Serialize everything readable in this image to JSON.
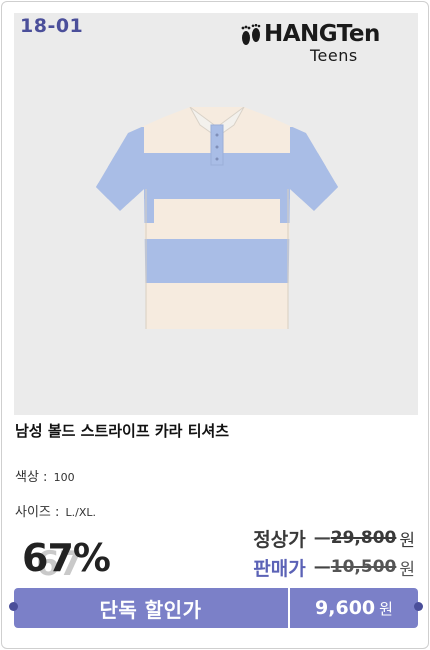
{
  "product": {
    "code": "18-01",
    "brand_name": "HANGTen",
    "brand_sub": "Teens",
    "title": "남성 볼드 스트라이프 카라 티셔츠",
    "color_label": "색상 :",
    "color_value": "100",
    "size_label": "사이즈 :",
    "size_value": "L./XL."
  },
  "pricing": {
    "discount_rate": "67%",
    "discount_shadow": "67",
    "regular_label": "정상가",
    "regular_price": "29,800",
    "sale_label": "판매가",
    "sale_price": "10,500",
    "dash": "—",
    "currency": "원"
  },
  "banner": {
    "label": "단독 할인가",
    "price": "9,600",
    "currency": "원"
  },
  "colors": {
    "accent": "#7b80c8",
    "code_text": "#4b4f9a",
    "stripe_blue": "#a9bde6",
    "stripe_cream": "#f6ebdf"
  },
  "icons": [
    "footprints-icon",
    "polo-shirt-image"
  ]
}
